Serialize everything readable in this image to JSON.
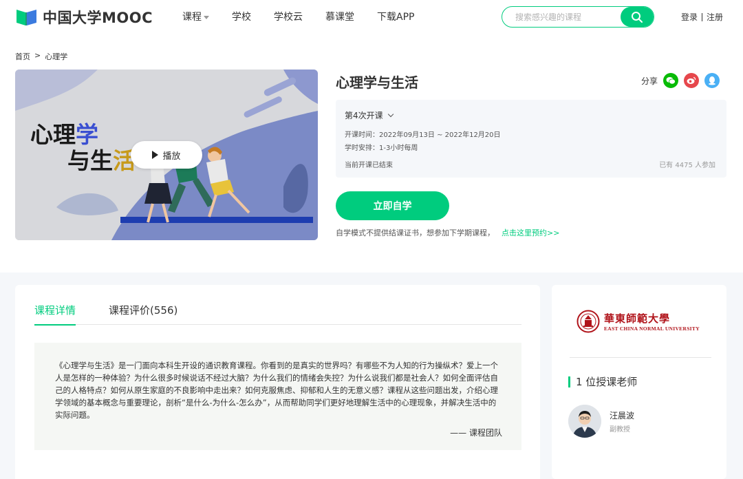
{
  "header": {
    "logo_text": "中国大学MOOC",
    "nav": [
      "课程",
      "学校",
      "学校云",
      "慕课堂",
      "下载APP"
    ],
    "search_placeholder": "搜索感兴趣的课程",
    "login": "登录",
    "register": "注册"
  },
  "breadcrumb": {
    "home": "首页",
    "sep": ">",
    "current": "心理学"
  },
  "cover": {
    "title_line1_a": "心理",
    "title_line1_b": "学",
    "title_line2_a": "与生",
    "title_line2_b": "活",
    "play_label": "播放"
  },
  "course": {
    "title": "心理学与生活",
    "share_label": "分享",
    "term": "第4次开课",
    "date_label": "开课时间：",
    "date_value": "2022年09月13日 ~ 2022年12月20日",
    "schedule_label": "学时安排：",
    "schedule_value": "1-3小时每周",
    "status": "当前开课已结束",
    "enrolled": "已有 4475 人参加",
    "study_button": "立即自学",
    "note": "自学模式不提供结课证书，想参加下学期课程，",
    "note_link": "点击这里预约>>"
  },
  "tabs": [
    "课程详情",
    "课程评价(556)"
  ],
  "description": {
    "text": "《心理学与生活》是一门面向本科生开设的通识教育课程。你看到的是真实的世界吗？有哪些不为人知的行为操纵术？爱上一个人是怎样的一种体验？为什么很多时候说话不经过大脑？为什么我们的情绪会失控？为什么说我们都是社会人？如何全面评估自己的人格特点？如何从原生家庭的不良影响中走出来？如何克服焦虑、抑郁和人生的无意义感？课程从这些问题出发，介绍心理学领域的基本概念与重要理论，剖析“是什么-为什么-怎么办”，从而帮助同学们更好地理解生活中的心理现象，并解决生活中的实际问题。",
    "signature": "—— 课程团队"
  },
  "sidebar": {
    "uni_cn": "華東師範大學",
    "uni_en": "EAST CHINA NORMAL UNIVERSITY",
    "teacher_count": "1 位授课老师",
    "teacher_name": "汪晨波",
    "teacher_title": "副教授"
  },
  "colors": {
    "accent": "#00cc7e",
    "uni_red": "#b0131a"
  }
}
